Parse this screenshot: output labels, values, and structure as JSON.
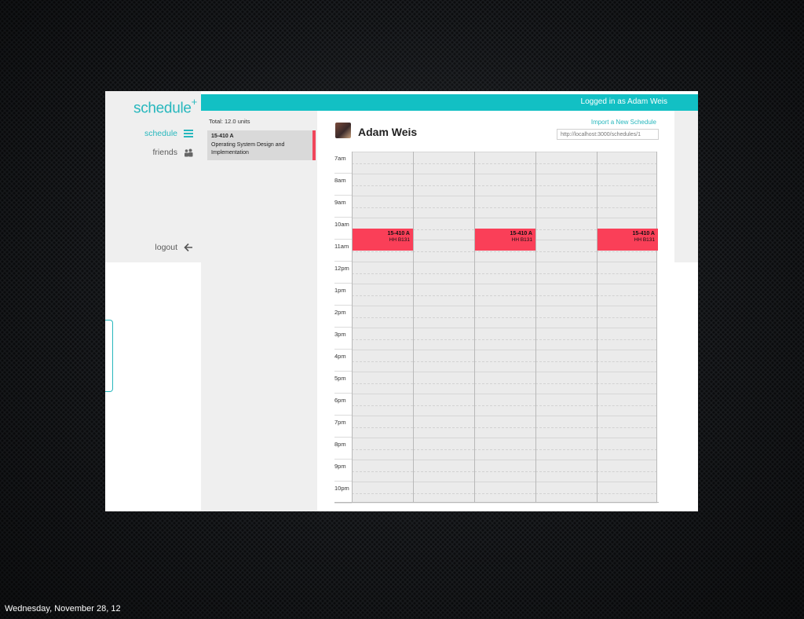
{
  "app": {
    "logo_text": "schedule",
    "logo_plus": "+",
    "accent_color": "#27b7bd",
    "event_color": "#fa3f58"
  },
  "nav": {
    "items": [
      {
        "label": "schedule",
        "icon": "list-icon",
        "active": true
      },
      {
        "label": "friends",
        "icon": "people-icon",
        "active": false
      }
    ],
    "logout_label": "logout",
    "logout_icon": "arrow-left-icon"
  },
  "header": {
    "login_status": "Logged in as Adam Weis"
  },
  "courses": {
    "total": "Total: 12.0 units",
    "items": [
      {
        "code": "15-410 A",
        "title": "Operating System Design and Implementation"
      }
    ]
  },
  "profile": {
    "name": "Adam Weis",
    "import_link": "Import a New Schedule",
    "share_url": "http://localhost:3000/schedules/1"
  },
  "calendar": {
    "hours": [
      "7am",
      "8am",
      "9am",
      "10am",
      "11am",
      "12pm",
      "1pm",
      "2pm",
      "3pm",
      "4pm",
      "5pm",
      "6pm",
      "7pm",
      "8pm",
      "9pm",
      "10pm"
    ],
    "events": [
      {
        "code": "15-410 A",
        "room": "HH B131",
        "day": 0
      },
      {
        "code": "15-410 A",
        "room": "HH B131",
        "day": 2
      },
      {
        "code": "15-410 A",
        "room": "HH B131",
        "day": 4
      }
    ]
  },
  "slide_footer": {
    "date": "Wednesday, November 28, 12"
  }
}
